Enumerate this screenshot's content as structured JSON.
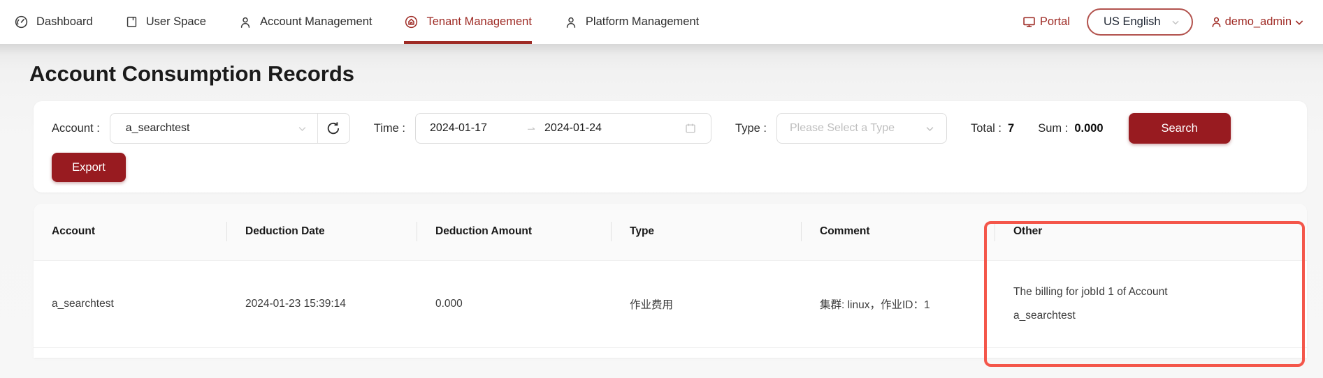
{
  "nav": {
    "items": [
      {
        "label": "Dashboard",
        "icon": "dashboard-icon",
        "active": false
      },
      {
        "label": "User Space",
        "icon": "notebook-icon",
        "active": false
      },
      {
        "label": "Account Management",
        "icon": "user-icon",
        "active": false
      },
      {
        "label": "Tenant Management",
        "icon": "tenant-icon",
        "active": true
      },
      {
        "label": "Platform Management",
        "icon": "user-icon",
        "active": false
      }
    ],
    "portal_label": "Portal",
    "language": "US English",
    "user": "demo_admin"
  },
  "page": {
    "title": "Account Consumption Records"
  },
  "filters": {
    "account_label": "Account :",
    "account_value": "a_searchtest",
    "time_label": "Time :",
    "time_start": "2024-01-17",
    "time_end": "2024-01-24",
    "type_label": "Type :",
    "type_placeholder": "Please Select a Type",
    "total_label": "Total :",
    "total_value": "7",
    "sum_label": "Sum :",
    "sum_value": "0.000",
    "search_label": "Search",
    "export_label": "Export"
  },
  "table": {
    "columns": [
      "Account",
      "Deduction Date",
      "Deduction Amount",
      "Type",
      "Comment",
      "Other"
    ],
    "rows": [
      {
        "account": "a_searchtest",
        "deduction_date": "2024-01-23 15:39:14",
        "deduction_amount": "0.000",
        "type": "作业费用",
        "comment": "集群: linux，作业ID：1",
        "other": "The billing for jobId 1 of Account a_searchtest"
      }
    ]
  },
  "colors": {
    "accent_button": "#981b20",
    "nav_active": "#9e2b25",
    "highlight_rectangle": "#f4564a"
  }
}
